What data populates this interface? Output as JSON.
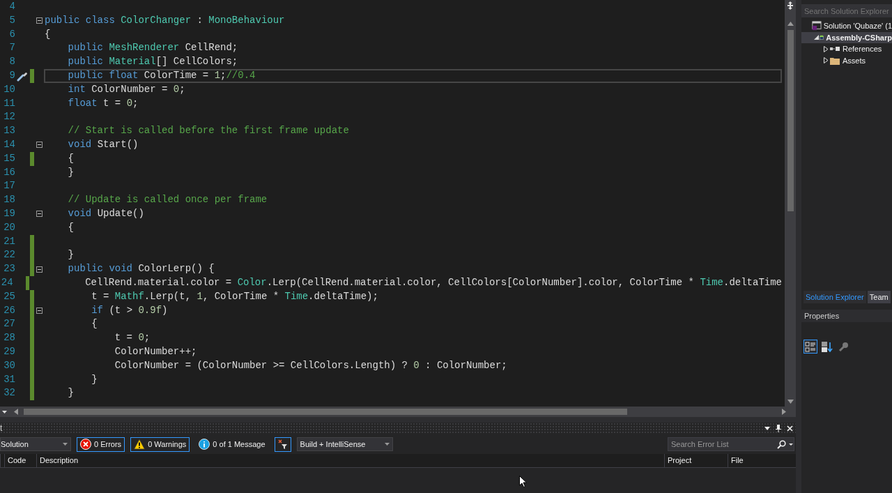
{
  "editor": {
    "lines": [
      {
        "number": "4",
        "modified": false,
        "collapsible": false,
        "current": false
      },
      {
        "number": "5",
        "tokens": [
          {
            "kind": "kw",
            "text": "public class "
          },
          {
            "kind": "type",
            "text": "ColorChanger"
          },
          {
            "kind": "plain",
            "text": " : "
          },
          {
            "kind": "type",
            "text": "MonoBehaviour"
          }
        ],
        "modified": false,
        "collapsible": true,
        "current": false
      },
      {
        "number": "6",
        "tokens": [
          {
            "kind": "plain",
            "text": "{"
          }
        ],
        "modified": false,
        "collapsible": false,
        "current": false
      },
      {
        "number": "7",
        "tokens": [
          {
            "kind": "kw",
            "text": "    public "
          },
          {
            "kind": "type",
            "text": "MeshRenderer"
          },
          {
            "kind": "plain",
            "text": " CellRend;"
          }
        ],
        "modified": false,
        "collapsible": false,
        "current": false
      },
      {
        "number": "8",
        "tokens": [
          {
            "kind": "kw",
            "text": "    public "
          },
          {
            "kind": "type",
            "text": "Material"
          },
          {
            "kind": "plain",
            "text": "[] CellColors;"
          }
        ],
        "modified": false,
        "collapsible": false,
        "current": false
      },
      {
        "number": "9",
        "tokens": [
          {
            "kind": "kw",
            "text": "    public float "
          },
          {
            "kind": "plain",
            "text": "ColorTime = "
          },
          {
            "kind": "num",
            "text": "1"
          },
          {
            "kind": "plain",
            "text": ";"
          },
          {
            "kind": "comment",
            "text": "//0.4"
          }
        ],
        "modified": true,
        "collapsible": false,
        "current": true
      },
      {
        "number": "10",
        "tokens": [
          {
            "kind": "kw",
            "text": "    int "
          },
          {
            "kind": "plain",
            "text": "ColorNumber = "
          },
          {
            "kind": "num",
            "text": "0"
          },
          {
            "kind": "plain",
            "text": ";"
          }
        ],
        "modified": false,
        "collapsible": false,
        "current": false
      },
      {
        "number": "11",
        "tokens": [
          {
            "kind": "kw",
            "text": "    float "
          },
          {
            "kind": "plain",
            "text": "t = "
          },
          {
            "kind": "num",
            "text": "0"
          },
          {
            "kind": "plain",
            "text": ";"
          }
        ],
        "modified": false,
        "collapsible": false,
        "current": false
      },
      {
        "number": "12",
        "modified": false,
        "collapsible": false,
        "current": false
      },
      {
        "number": "13",
        "tokens": [
          {
            "kind": "comment",
            "text": "    // Start is called before the first frame update"
          }
        ],
        "modified": false,
        "collapsible": false,
        "current": false
      },
      {
        "number": "14",
        "tokens": [
          {
            "kind": "kw",
            "text": "    void "
          },
          {
            "kind": "plain",
            "text": "Start()"
          }
        ],
        "modified": false,
        "collapsible": true,
        "current": false
      },
      {
        "number": "15",
        "tokens": [
          {
            "kind": "plain",
            "text": "    {"
          }
        ],
        "modified": true,
        "collapsible": false,
        "current": false
      },
      {
        "number": "16",
        "tokens": [
          {
            "kind": "plain",
            "text": "    }"
          }
        ],
        "modified": false,
        "collapsible": false,
        "current": false
      },
      {
        "number": "17",
        "modified": false,
        "collapsible": false,
        "current": false
      },
      {
        "number": "18",
        "tokens": [
          {
            "kind": "comment",
            "text": "    // Update is called once per frame"
          }
        ],
        "modified": false,
        "collapsible": false,
        "current": false
      },
      {
        "number": "19",
        "tokens": [
          {
            "kind": "kw",
            "text": "    void "
          },
          {
            "kind": "plain",
            "text": "Update()"
          }
        ],
        "modified": false,
        "collapsible": true,
        "current": false
      },
      {
        "number": "20",
        "tokens": [
          {
            "kind": "plain",
            "text": "    {"
          }
        ],
        "modified": false,
        "collapsible": false,
        "current": false
      },
      {
        "number": "21",
        "modified": true,
        "collapsible": false,
        "current": false
      },
      {
        "number": "22",
        "tokens": [
          {
            "kind": "plain",
            "text": "    }"
          }
        ],
        "modified": true,
        "collapsible": false,
        "current": false
      },
      {
        "number": "23",
        "tokens": [
          {
            "kind": "kw",
            "text": "    public void "
          },
          {
            "kind": "plain",
            "text": "ColorLerp() {"
          }
        ],
        "modified": true,
        "collapsible": true,
        "current": false
      },
      {
        "number": "24",
        "tokens": [
          {
            "kind": "plain",
            "text": "        CellRend.material.color = "
          },
          {
            "kind": "type",
            "text": "Color"
          },
          {
            "kind": "plain",
            "text": ".Lerp(CellRend.material.color, CellColors[ColorNumber].color, ColorTime * "
          },
          {
            "kind": "type",
            "text": "Time"
          },
          {
            "kind": "plain",
            "text": ".deltaTime"
          }
        ],
        "modified": true,
        "collapsible": false,
        "current": false
      },
      {
        "number": "25",
        "tokens": [
          {
            "kind": "plain",
            "text": "        t = "
          },
          {
            "kind": "type",
            "text": "Mathf"
          },
          {
            "kind": "plain",
            "text": ".Lerp(t, "
          },
          {
            "kind": "num",
            "text": "1"
          },
          {
            "kind": "plain",
            "text": ", ColorTime * "
          },
          {
            "kind": "type",
            "text": "Time"
          },
          {
            "kind": "plain",
            "text": ".deltaTime);"
          }
        ],
        "modified": true,
        "collapsible": false,
        "current": false
      },
      {
        "number": "26",
        "tokens": [
          {
            "kind": "kw",
            "text": "        if "
          },
          {
            "kind": "plain",
            "text": "(t > "
          },
          {
            "kind": "num",
            "text": "0.9f"
          },
          {
            "kind": "plain",
            "text": ")"
          }
        ],
        "modified": true,
        "collapsible": true,
        "current": false
      },
      {
        "number": "27",
        "tokens": [
          {
            "kind": "plain",
            "text": "        {"
          }
        ],
        "modified": true,
        "collapsible": false,
        "current": false
      },
      {
        "number": "28",
        "tokens": [
          {
            "kind": "plain",
            "text": "            t = "
          },
          {
            "kind": "num",
            "text": "0"
          },
          {
            "kind": "plain",
            "text": ";"
          }
        ],
        "modified": true,
        "collapsible": false,
        "current": false
      },
      {
        "number": "29",
        "tokens": [
          {
            "kind": "plain",
            "text": "            ColorNumber++;"
          }
        ],
        "modified": true,
        "collapsible": false,
        "current": false
      },
      {
        "number": "30",
        "tokens": [
          {
            "kind": "plain",
            "text": "            ColorNumber = (ColorNumber >= CellColors.Length) ? "
          },
          {
            "kind": "num",
            "text": "0"
          },
          {
            "kind": "plain",
            "text": " : ColorNumber;"
          }
        ],
        "modified": true,
        "collapsible": false,
        "current": false
      },
      {
        "number": "31",
        "tokens": [
          {
            "kind": "plain",
            "text": "        }"
          }
        ],
        "modified": true,
        "collapsible": false,
        "current": false
      },
      {
        "number": "32",
        "tokens": [
          {
            "kind": "plain",
            "text": "    }"
          }
        ],
        "modified": true,
        "collapsible": false,
        "current": false
      }
    ]
  },
  "error_list": {
    "title": "t",
    "scope": "Solution",
    "filters": [
      {
        "kind": "error",
        "label": "0 Errors",
        "selected": true
      },
      {
        "kind": "warning",
        "label": "0 Warnings",
        "selected": true
      },
      {
        "kind": "info",
        "label": "0 of 1 Message",
        "selected": false
      }
    ],
    "filter_toggle": {
      "selected": true
    },
    "source": "Build + IntelliSense",
    "search": {
      "placeholder": "Search Error List"
    },
    "columns": [
      "Code",
      "Description",
      "Project",
      "File"
    ]
  },
  "solution_explorer": {
    "search": {
      "placeholder": "Search Solution Explorer"
    },
    "tree": [
      {
        "label": "Solution 'Qubaze' (1",
        "kind": "solution",
        "selected": false,
        "children": [
          {
            "label": "Assembly-CSharp",
            "kind": "project",
            "selected": true,
            "expanded": true,
            "children": [
              {
                "label": "References",
                "kind": "references",
                "selected": false,
                "expanded": false
              },
              {
                "label": "Assets",
                "kind": "folder",
                "selected": false,
                "expanded": false
              }
            ]
          }
        ]
      }
    ],
    "tabs": [
      {
        "label": "Solution Explorer",
        "selected": true
      },
      {
        "label": "Team",
        "selected": false
      }
    ]
  },
  "properties": {
    "title": "Properties",
    "toolbar": [
      {
        "kind": "categorized",
        "selected": true
      },
      {
        "kind": "alphabetical",
        "selected": false
      },
      {
        "kind": "property-pages",
        "selected": false
      }
    ]
  }
}
